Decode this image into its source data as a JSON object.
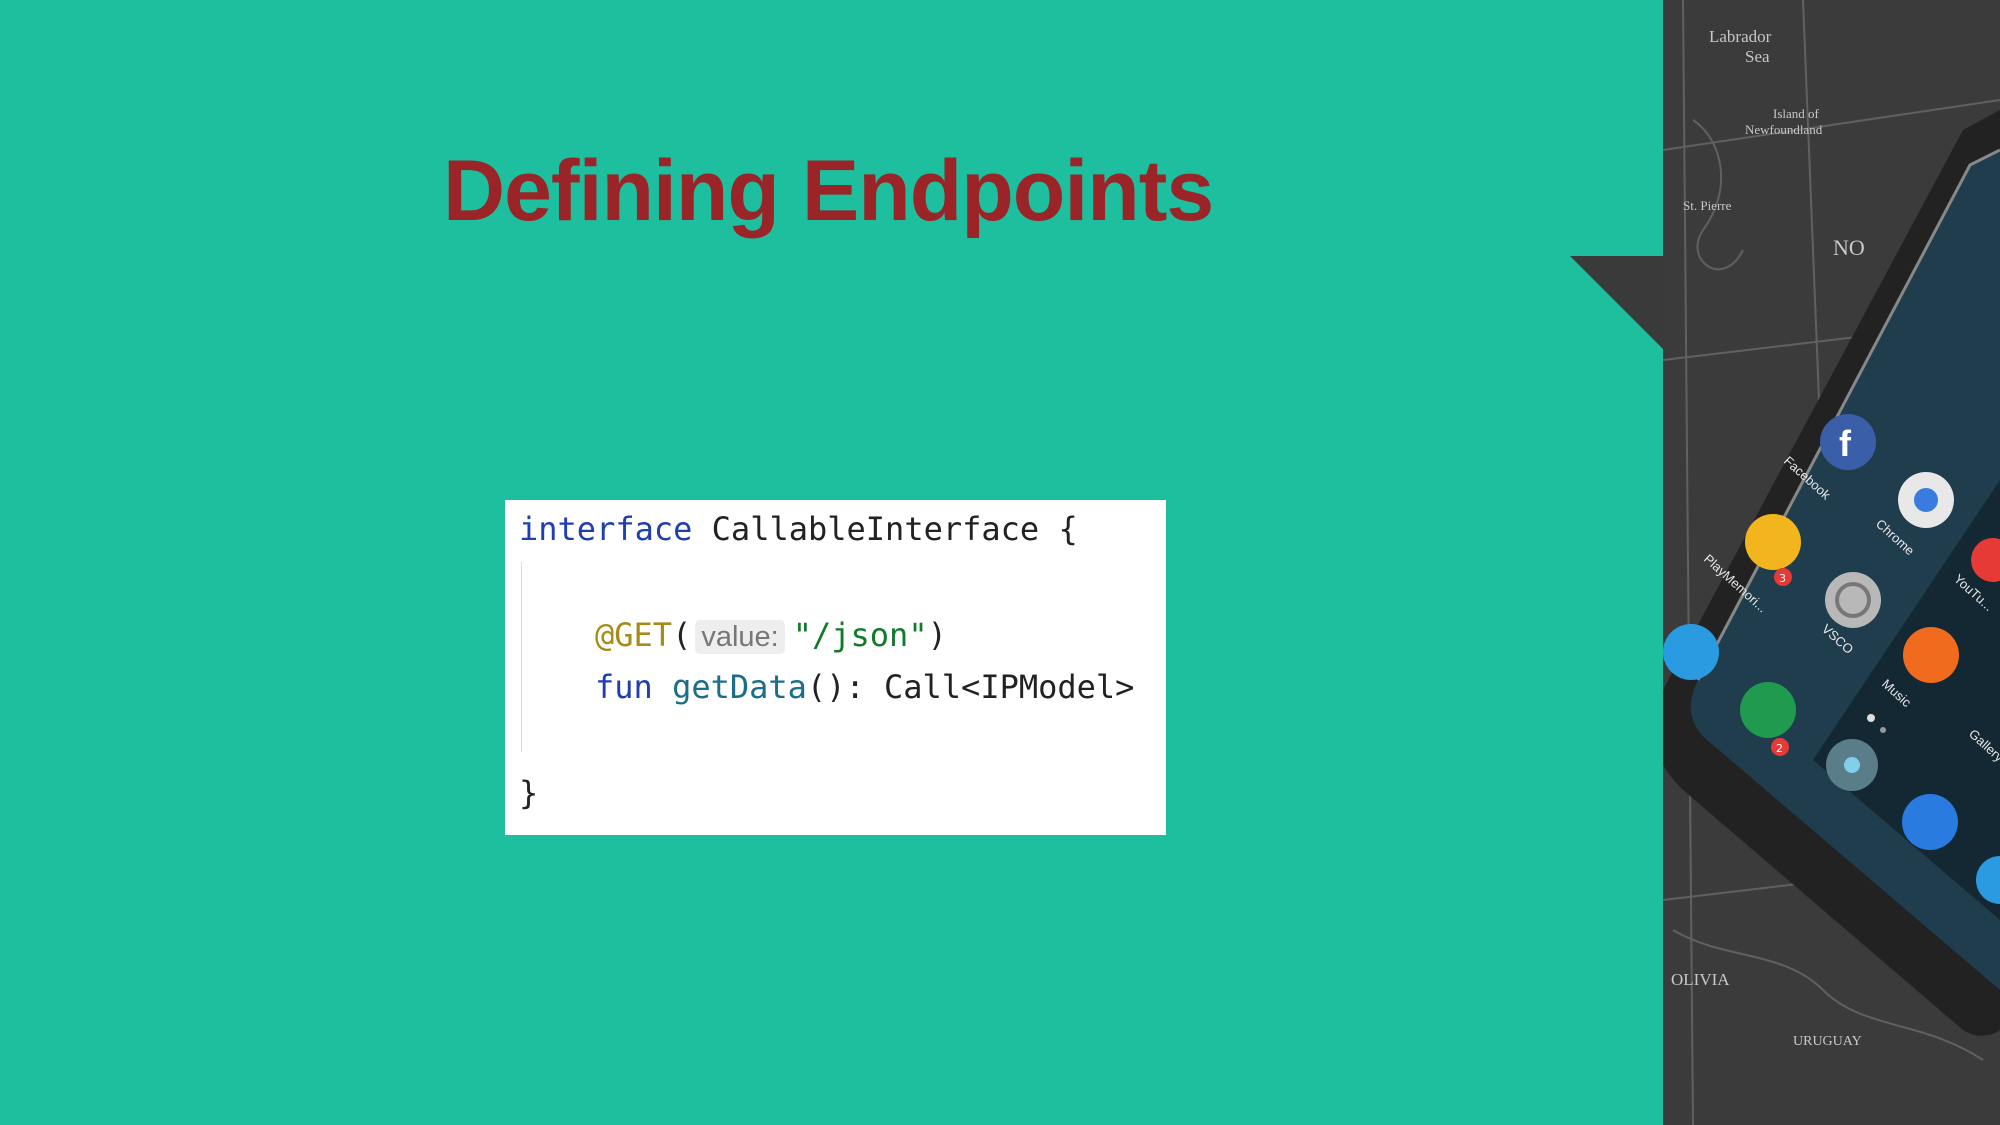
{
  "slide": {
    "title": "Defining Endpoints"
  },
  "code": {
    "line1_keyword": "interface",
    "line1_name": " CallableInterface {",
    "line3_annotation": "@GET",
    "line3_open": "(",
    "line3_hint": "value:",
    "line3_string": "\"/json\"",
    "line3_close": ")",
    "line4_keyword": "fun",
    "line4_function": "getData",
    "line4_rest": "(): Call<IPModel>",
    "line6_close": "}"
  },
  "decor": {
    "map_labels": [
      "Labrador",
      "Sea",
      "Island of",
      "Newfoundland",
      "St. Pierre",
      "NO",
      "OLIVIA",
      "URUGUAY"
    ],
    "app_labels": [
      "Facebook",
      "Chrome",
      "PlayMemori...",
      "VSCO",
      "YouTu...",
      "Music",
      "Gallery"
    ],
    "badges": [
      "3",
      "2"
    ]
  },
  "colors": {
    "background": "#1dbf9f",
    "title": "#9a2427",
    "code_keyword": "#1f3fb0",
    "code_annotation": "#a78b1a",
    "code_string": "#127a2b"
  }
}
